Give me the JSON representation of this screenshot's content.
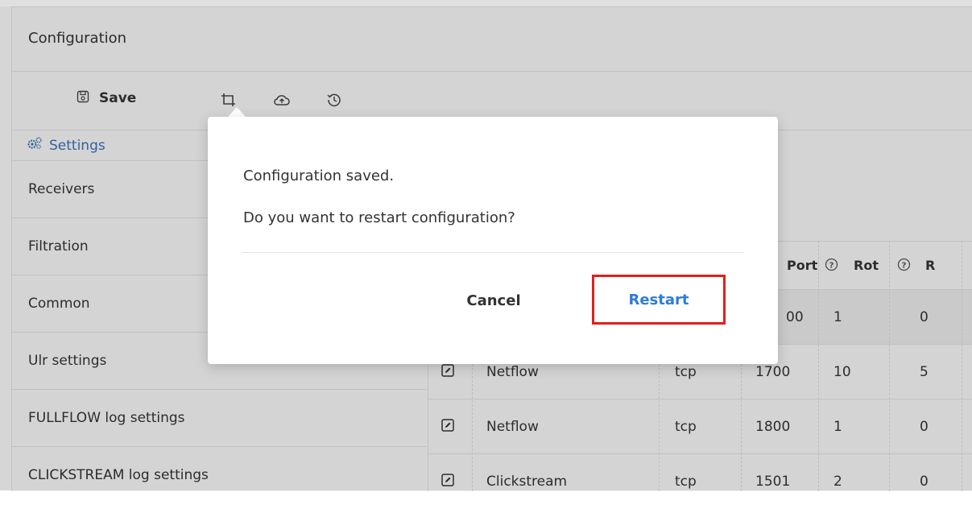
{
  "header": {
    "title": "Configuration"
  },
  "toolbar": {
    "save_label": "Save",
    "icons": [
      "save-icon",
      "crop-icon",
      "cloud-upload-icon",
      "history-icon"
    ]
  },
  "settings_tab": {
    "label": "Settings",
    "icon": "settings-gears-icon",
    "color": "#3a6fb5"
  },
  "sidebar": {
    "items": [
      {
        "label": "Receivers"
      },
      {
        "label": "Filtration"
      },
      {
        "label": "Common"
      },
      {
        "label": "Ulr settings"
      },
      {
        "label": "FULLFLOW log settings"
      },
      {
        "label": "CLICKSTREAM log settings"
      }
    ]
  },
  "table": {
    "headers": [
      "Port",
      "Rot",
      "R"
    ],
    "rows": [
      {
        "name": "",
        "protocol": "",
        "port": "00",
        "rot": "1",
        "r": "0"
      },
      {
        "name": "Netflow",
        "protocol": "tcp",
        "port": "1700",
        "rot": "10",
        "r": "5"
      },
      {
        "name": "Netflow",
        "protocol": "tcp",
        "port": "1800",
        "rot": "1",
        "r": "0"
      },
      {
        "name": "Clickstream",
        "protocol": "tcp",
        "port": "1501",
        "rot": "2",
        "r": "0"
      }
    ]
  },
  "dialog": {
    "message": "Configuration saved.",
    "question": "Do you want to restart configuration?",
    "cancel_label": "Cancel",
    "restart_label": "Restart",
    "restart_color": "#2f7bd8",
    "highlight_color": "#e0201b"
  }
}
